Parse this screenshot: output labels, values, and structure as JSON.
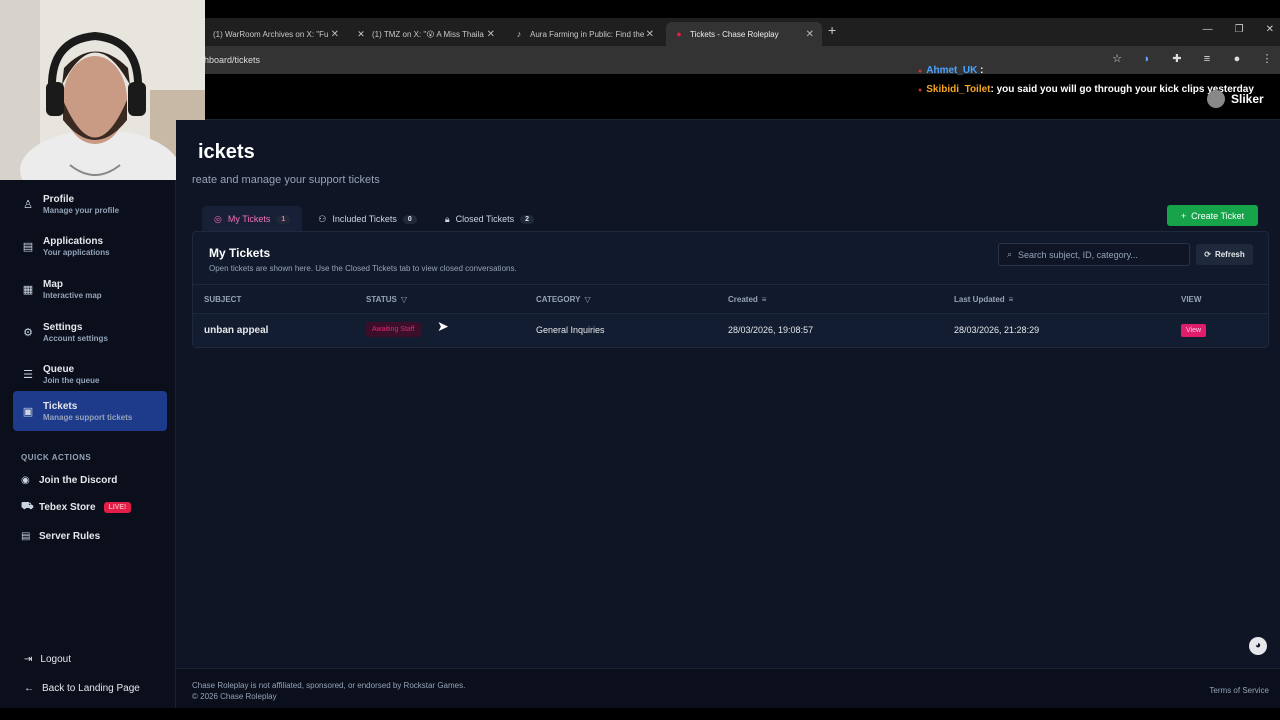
{
  "browser": {
    "tabs": [
      {
        "title": "(1) WarRoom Archives on X: \"Fu",
        "icon": "x-icon"
      },
      {
        "title": "(1) TMZ on X: \"😮 A Miss Thaila",
        "icon": "x-icon"
      },
      {
        "title": "Aura Farming in Public: Find the",
        "icon": "tiktok-icon"
      },
      {
        "title": "Tickets - Chase Roleplay",
        "icon": "site-icon"
      }
    ],
    "url": "hboard/tickets"
  },
  "overlay": {
    "chat": [
      {
        "user": "Ahmet_UK",
        "message": ""
      },
      {
        "user": "Skibidi_Toilet",
        "message": ": you said you will go through your kick clips yesterday"
      }
    ],
    "streamer_name": "Sliker"
  },
  "sidebar": {
    "items": [
      {
        "title": "Profile",
        "subtitle": "Manage your profile",
        "icon": "user-icon"
      },
      {
        "title": "Applications",
        "subtitle": "Your applications",
        "icon": "document-icon"
      },
      {
        "title": "Map",
        "subtitle": "Interactive map",
        "icon": "map-icon"
      },
      {
        "title": "Settings",
        "subtitle": "Account settings",
        "icon": "gear-icon"
      },
      {
        "title": "Queue",
        "subtitle": "Join the queue",
        "icon": "list-icon"
      },
      {
        "title": "Tickets",
        "subtitle": "Manage support tickets",
        "icon": "ticket-icon"
      }
    ],
    "quick_actions_title": "QUICK ACTIONS",
    "quick_actions": [
      {
        "label": "Join the Discord",
        "icon": "discord-icon"
      },
      {
        "label": "Tebex Store",
        "icon": "cart-icon",
        "badge": "LIVE!"
      },
      {
        "label": "Server Rules",
        "icon": "rules-icon"
      }
    ],
    "logout": "Logout",
    "back": "Back to Landing Page"
  },
  "main": {
    "title": "ickets",
    "subtitle": "reate and manage your support tickets",
    "tabs": [
      {
        "label": "My Tickets",
        "count": "1"
      },
      {
        "label": "Included Tickets",
        "count": "0"
      },
      {
        "label": "Closed Tickets",
        "count": "2"
      }
    ],
    "create_button": "Create Ticket",
    "card_title": "My Tickets",
    "card_desc": "Open tickets are shown here. Use the Closed Tickets tab to view closed conversations.",
    "search_placeholder": "Search subject, ID, category...",
    "refresh_label": "Refresh",
    "columns": [
      "SUBJECT",
      "STATUS",
      "CATEGORY",
      "Created",
      "Last Updated",
      "VIEW"
    ],
    "rows": [
      {
        "subject": "unban appeal",
        "status": "Awaiting Staff",
        "category": "General Inquiries",
        "created": "28/03/2026, 19:08:57",
        "updated": "28/03/2026, 21:28:29",
        "view": "View"
      }
    ]
  },
  "footer": {
    "line1": "Chase Roleplay is not affiliated, sponsored, or endorsed by Rockstar Games.",
    "line2": "© 2026 Chase Roleplay",
    "terms": "Terms of Service"
  }
}
